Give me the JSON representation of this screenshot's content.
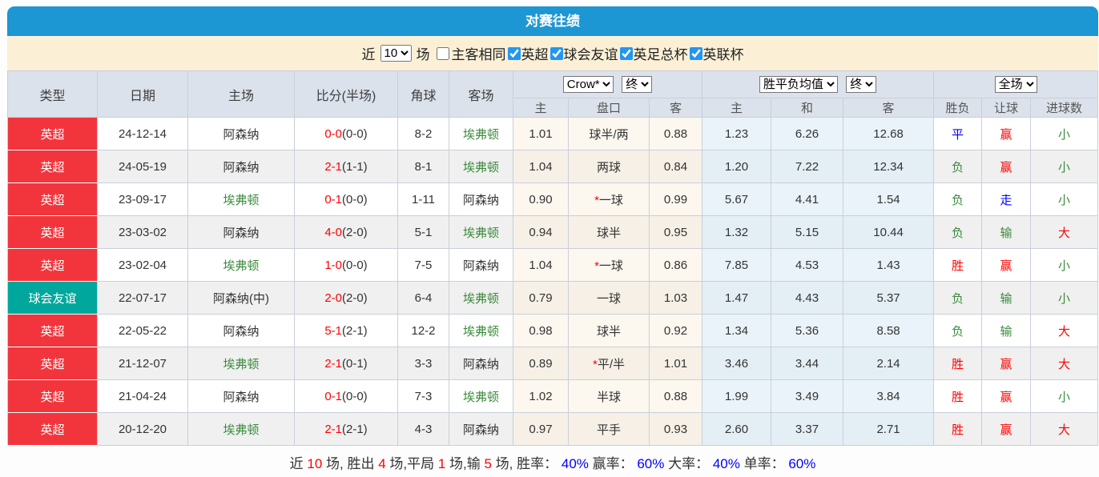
{
  "title": "对赛往绩",
  "colors": {
    "accent_blue": "#1d96d4",
    "filter_bg": "#fbf0d6",
    "header_bg": "#dce2ec",
    "league_red_bg": "#f2353c",
    "friendly_teal_bg": "#00a79c",
    "red_text": "#ff0000",
    "green_text": "#3a8a3a",
    "blue_text": "#0000ff",
    "dark_text": "#333333",
    "ah_tint": "#fcf7ef",
    "eu_tint": "#eaf3f9"
  },
  "filter": {
    "near_label": "近",
    "count_value": "10",
    "games_label": "场",
    "same_venue": {
      "label": "主客相同",
      "checked": false
    },
    "leagues": [
      {
        "label": "英超",
        "checked": true
      },
      {
        "label": "球会友谊",
        "checked": true
      },
      {
        "label": "英足总杯",
        "checked": true
      },
      {
        "label": "英联杯",
        "checked": true
      }
    ]
  },
  "table": {
    "selects": {
      "bookmaker": "Crow*",
      "ah_time": "终",
      "eu_avg": "胜平负均值",
      "eu_time": "终",
      "scope": "全场"
    },
    "columns": {
      "type": "类型",
      "date": "日期",
      "home": "主场",
      "score": "比分(半场)",
      "corner": "角球",
      "away": "客场",
      "ah_home": "主",
      "ah_line": "盘口",
      "ah_away": "客",
      "eu_home": "主",
      "eu_draw": "和",
      "eu_away": "客",
      "result": "胜负",
      "handicap_result": "让球",
      "goals": "进球数"
    },
    "rows": [
      {
        "type": {
          "label": "英超",
          "bg": "red"
        },
        "date": "24-12-14",
        "home": {
          "name": "阿森纳",
          "color": "dark"
        },
        "score": "0-0",
        "half": "(0-0)",
        "corner": "8-2",
        "away": {
          "name": "埃弗顿",
          "color": "green"
        },
        "ah": {
          "home": "1.01",
          "star": false,
          "line": "球半/两",
          "away": "0.88"
        },
        "eu": {
          "home": "1.23",
          "draw": "6.26",
          "away": "12.68"
        },
        "result": {
          "label": "平",
          "color": "blue"
        },
        "let": {
          "label": "赢",
          "color": "red"
        },
        "goals": {
          "label": "小",
          "color": "green"
        }
      },
      {
        "type": {
          "label": "英超",
          "bg": "red"
        },
        "date": "24-05-19",
        "home": {
          "name": "阿森纳",
          "color": "dark"
        },
        "score": "2-1",
        "half": "(1-1)",
        "corner": "8-1",
        "away": {
          "name": "埃弗顿",
          "color": "green"
        },
        "ah": {
          "home": "1.04",
          "star": false,
          "line": "两球",
          "away": "0.84"
        },
        "eu": {
          "home": "1.20",
          "draw": "7.22",
          "away": "12.34"
        },
        "result": {
          "label": "负",
          "color": "green"
        },
        "let": {
          "label": "赢",
          "color": "red"
        },
        "goals": {
          "label": "小",
          "color": "green"
        }
      },
      {
        "type": {
          "label": "英超",
          "bg": "red"
        },
        "date": "23-09-17",
        "home": {
          "name": "埃弗顿",
          "color": "green"
        },
        "score": "0-1",
        "half": "(0-0)",
        "corner": "1-11",
        "away": {
          "name": "阿森纳",
          "color": "dark"
        },
        "ah": {
          "home": "0.90",
          "star": true,
          "line": "一球",
          "away": "0.99"
        },
        "eu": {
          "home": "5.67",
          "draw": "4.41",
          "away": "1.54"
        },
        "result": {
          "label": "负",
          "color": "green"
        },
        "let": {
          "label": "走",
          "color": "blue"
        },
        "goals": {
          "label": "小",
          "color": "green"
        }
      },
      {
        "type": {
          "label": "英超",
          "bg": "red"
        },
        "date": "23-03-02",
        "home": {
          "name": "阿森纳",
          "color": "dark"
        },
        "score": "4-0",
        "half": "(2-0)",
        "corner": "5-1",
        "away": {
          "name": "埃弗顿",
          "color": "green"
        },
        "ah": {
          "home": "0.94",
          "star": false,
          "line": "球半",
          "away": "0.95"
        },
        "eu": {
          "home": "1.32",
          "draw": "5.15",
          "away": "10.44"
        },
        "result": {
          "label": "负",
          "color": "green"
        },
        "let": {
          "label": "输",
          "color": "green"
        },
        "goals": {
          "label": "大",
          "color": "red"
        }
      },
      {
        "type": {
          "label": "英超",
          "bg": "red"
        },
        "date": "23-02-04",
        "home": {
          "name": "埃弗顿",
          "color": "green"
        },
        "score": "1-0",
        "half": "(0-0)",
        "corner": "7-5",
        "away": {
          "name": "阿森纳",
          "color": "dark"
        },
        "ah": {
          "home": "1.04",
          "star": true,
          "line": "一球",
          "away": "0.86"
        },
        "eu": {
          "home": "7.85",
          "draw": "4.53",
          "away": "1.43"
        },
        "result": {
          "label": "胜",
          "color": "red"
        },
        "let": {
          "label": "赢",
          "color": "red"
        },
        "goals": {
          "label": "小",
          "color": "green"
        }
      },
      {
        "type": {
          "label": "球会友谊",
          "bg": "teal"
        },
        "date": "22-07-17",
        "home": {
          "name": "阿森纳(中)",
          "color": "dark"
        },
        "score": "2-0",
        "half": "(2-0)",
        "corner": "6-4",
        "away": {
          "name": "埃弗顿",
          "color": "green"
        },
        "ah": {
          "home": "0.79",
          "star": false,
          "line": "一球",
          "away": "1.03"
        },
        "eu": {
          "home": "1.47",
          "draw": "4.43",
          "away": "5.37"
        },
        "result": {
          "label": "负",
          "color": "green"
        },
        "let": {
          "label": "输",
          "color": "green"
        },
        "goals": {
          "label": "小",
          "color": "green"
        }
      },
      {
        "type": {
          "label": "英超",
          "bg": "red"
        },
        "date": "22-05-22",
        "home": {
          "name": "阿森纳",
          "color": "dark"
        },
        "score": "5-1",
        "half": "(2-1)",
        "corner": "12-2",
        "away": {
          "name": "埃弗顿",
          "color": "green"
        },
        "ah": {
          "home": "0.98",
          "star": false,
          "line": "球半",
          "away": "0.92"
        },
        "eu": {
          "home": "1.34",
          "draw": "5.36",
          "away": "8.58"
        },
        "result": {
          "label": "负",
          "color": "green"
        },
        "let": {
          "label": "输",
          "color": "green"
        },
        "goals": {
          "label": "大",
          "color": "red"
        }
      },
      {
        "type": {
          "label": "英超",
          "bg": "red"
        },
        "date": "21-12-07",
        "home": {
          "name": "埃弗顿",
          "color": "green"
        },
        "score": "2-1",
        "half": "(0-1)",
        "corner": "3-3",
        "away": {
          "name": "阿森纳",
          "color": "dark"
        },
        "ah": {
          "home": "0.89",
          "star": true,
          "line": "平/半",
          "away": "1.01"
        },
        "eu": {
          "home": "3.46",
          "draw": "3.44",
          "away": "2.14"
        },
        "result": {
          "label": "胜",
          "color": "red"
        },
        "let": {
          "label": "赢",
          "color": "red"
        },
        "goals": {
          "label": "大",
          "color": "red"
        }
      },
      {
        "type": {
          "label": "英超",
          "bg": "red"
        },
        "date": "21-04-24",
        "home": {
          "name": "阿森纳",
          "color": "dark"
        },
        "score": "0-1",
        "half": "(0-0)",
        "corner": "7-3",
        "away": {
          "name": "埃弗顿",
          "color": "green"
        },
        "ah": {
          "home": "1.02",
          "star": false,
          "line": "半球",
          "away": "0.88"
        },
        "eu": {
          "home": "1.99",
          "draw": "3.49",
          "away": "3.84"
        },
        "result": {
          "label": "胜",
          "color": "red"
        },
        "let": {
          "label": "赢",
          "color": "red"
        },
        "goals": {
          "label": "小",
          "color": "green"
        }
      },
      {
        "type": {
          "label": "英超",
          "bg": "red"
        },
        "date": "20-12-20",
        "home": {
          "name": "埃弗顿",
          "color": "green"
        },
        "score": "2-1",
        "half": "(2-1)",
        "corner": "4-3",
        "away": {
          "name": "阿森纳",
          "color": "dark"
        },
        "ah": {
          "home": "0.97",
          "star": false,
          "line": "平手",
          "away": "0.93"
        },
        "eu": {
          "home": "2.60",
          "draw": "3.37",
          "away": "2.71"
        },
        "result": {
          "label": "胜",
          "color": "red"
        },
        "let": {
          "label": "赢",
          "color": "red"
        },
        "goals": {
          "label": "大",
          "color": "red"
        }
      }
    ]
  },
  "summary": {
    "segments": [
      {
        "text": "近 ",
        "color": "dark"
      },
      {
        "text": "10",
        "color": "red"
      },
      {
        "text": " 场, 胜出 ",
        "color": "dark"
      },
      {
        "text": "4",
        "color": "red"
      },
      {
        "text": " 场,平局 ",
        "color": "dark"
      },
      {
        "text": "1",
        "color": "red"
      },
      {
        "text": " 场,输 ",
        "color": "dark"
      },
      {
        "text": "5",
        "color": "red"
      },
      {
        "text": " 场, 胜率： ",
        "color": "dark"
      },
      {
        "text": "40%",
        "color": "blue"
      },
      {
        "text": " 赢率： ",
        "color": "dark"
      },
      {
        "text": "60%",
        "color": "blue"
      },
      {
        "text": " 大率： ",
        "color": "dark"
      },
      {
        "text": "40%",
        "color": "blue"
      },
      {
        "text": " 单率： ",
        "color": "dark"
      },
      {
        "text": "60%",
        "color": "blue"
      }
    ]
  }
}
